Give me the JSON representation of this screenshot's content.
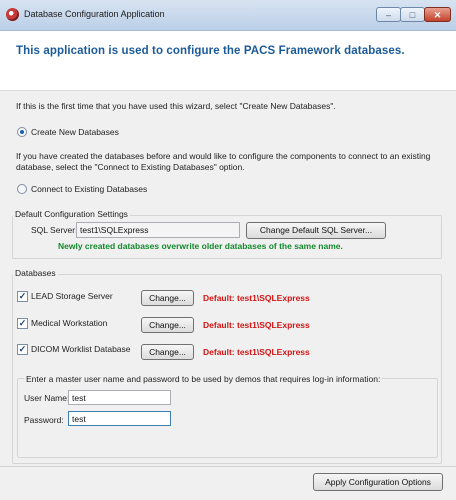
{
  "window": {
    "title": "Database Configuration Application",
    "controls": {
      "minimize": "–",
      "maximize": "□",
      "close": "✕"
    }
  },
  "header": {
    "text": "This application is used to configure the PACS Framework databases."
  },
  "intro": {
    "first_time_text": "If this is the first time that you have used this wizard, select \"Create New Databases\".",
    "create_new_label": "Create New Databases",
    "existing_text": "If you have created the databases before and would like to configure the components to connect to an existing database, select the \"Connect to Existing Databases\" option.",
    "connect_existing_label": "Connect to Existing Databases",
    "selected": "create_new"
  },
  "default_settings": {
    "group_label": "Default Configuration Settings",
    "sql_server_label": "SQL Server:",
    "sql_server_value": "test1\\SQLExpress",
    "change_button": "Change Default SQL Server...",
    "note": "Newly created databases overwrite older databases of the same name."
  },
  "databases": {
    "group_label": "Databases",
    "items": [
      {
        "label": "LEAD Storage Server",
        "checked": true,
        "button": "Change...",
        "status": "Default: test1\\SQLExpress"
      },
      {
        "label": "Medical Workstation",
        "checked": true,
        "button": "Change...",
        "status": "Default: test1\\SQLExpress"
      },
      {
        "label": "DICOM Worklist Database",
        "checked": true,
        "button": "Change...",
        "status": "Default: test1\\SQLExpress"
      }
    ],
    "credentials": {
      "prompt": "Enter a master user name and password to be used by demos that requires log-in information:",
      "username_label": "User Name:",
      "username_value": "test",
      "password_label": "Password:",
      "password_value": "test"
    }
  },
  "footer": {
    "apply_button": "Apply Configuration Options"
  },
  "colors": {
    "header_blue": "#1b5a98",
    "note_green": "#14892c",
    "status_red": "#d21414"
  }
}
